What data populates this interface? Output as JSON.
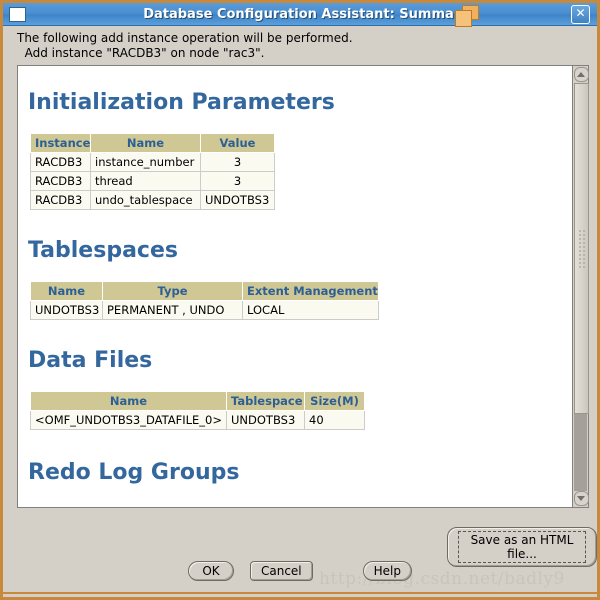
{
  "window": {
    "title": "Database Configuration Assistant: Summa",
    "sys_icon": "window-icon",
    "close_label": "✕",
    "overlay_icon": "folder-stack-icon"
  },
  "header": {
    "line1": "The following add instance operation will be performed.",
    "line2": "  Add instance \"RACDB3\" on node \"rac3\"."
  },
  "sections": [
    {
      "heading": "Initialization Parameters",
      "columns": [
        "Instance",
        "Name",
        "Value"
      ],
      "rows": [
        [
          "RACDB3",
          "instance_number",
          "3"
        ],
        [
          "RACDB3",
          "thread",
          "3"
        ],
        [
          "RACDB3",
          "undo_tablespace",
          "UNDOTBS3"
        ]
      ]
    },
    {
      "heading": "Tablespaces",
      "columns": [
        "Name",
        "Type",
        "Extent Management"
      ],
      "rows": [
        [
          "UNDOTBS3",
          "PERMANENT , UNDO",
          "LOCAL"
        ]
      ]
    },
    {
      "heading": "Data Files",
      "columns": [
        "Name",
        "Tablespace",
        "Size(M)"
      ],
      "rows": [
        [
          "<OMF_UNDOTBS3_DATAFILE_0>",
          "UNDOTBS3",
          "40"
        ]
      ]
    },
    {
      "heading": "Redo Log Groups",
      "columns": [],
      "rows": []
    }
  ],
  "buttons": {
    "save_html": "Save as an HTML file...",
    "ok": "OK",
    "cancel": "Cancel",
    "help": "Help"
  },
  "scrollbar": {
    "up_icon": "scroll-up-arrow-icon",
    "down_icon": "scroll-down-arrow-icon"
  },
  "watermark": "http://blog.csdn.net/badly9",
  "colors": {
    "titlebar_blue": "#4a8fd0",
    "window_border_orange": "#c8893c",
    "heading_blue": "#33679e",
    "table_header_khaki": "#cfc894",
    "table_cell_cream": "#fbfaf0",
    "dialog_gray": "#d4d0c8"
  }
}
